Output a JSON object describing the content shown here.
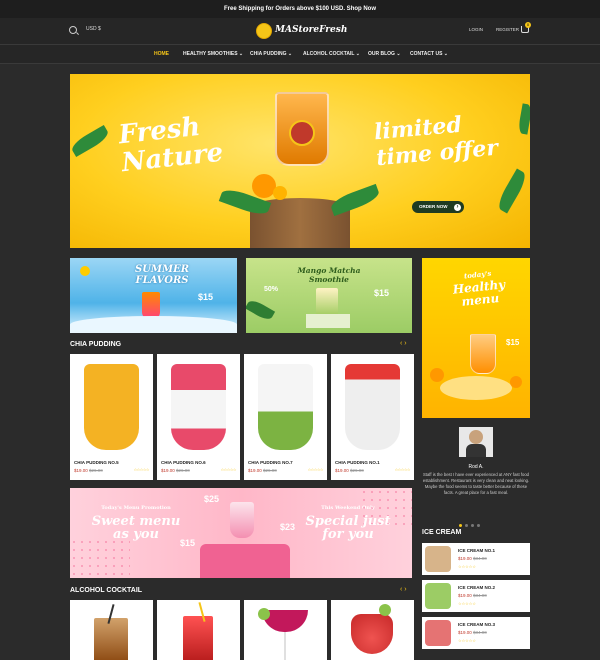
{
  "topbar": {
    "text": "Free Shipping for Orders above $100 USD. Shop Now"
  },
  "header": {
    "currency": "USD $",
    "logo_text": "MAStoreFresh",
    "login": "LOGIN",
    "register": "REGISTER",
    "cart_count": "0"
  },
  "nav": {
    "items": [
      {
        "label": "HOME"
      },
      {
        "label": "HEALTHY SMOOTHIES ⌄"
      },
      {
        "label": "CHIA PUDDING ⌄"
      },
      {
        "label": "ALCOHOL COCKTAIL ⌄"
      },
      {
        "label": "OUR BLOG ⌄"
      },
      {
        "label": "CONTACT US ⌄"
      }
    ]
  },
  "hero": {
    "line1": "Fresh",
    "line2": "Nature",
    "line3": "limited",
    "line4": "time offer",
    "button": "ORDER NOW"
  },
  "banners": {
    "summer_line1": "SUMMER",
    "summer_line2": "FLAVORS",
    "summer_price": "$15",
    "matcha_line1": "Mango Matcha",
    "matcha_line2": "Smoothie",
    "matcha_badge": "50%",
    "matcha_price": "$15",
    "side_line1": "today's",
    "side_line2": "Healthy",
    "side_line3": "menu",
    "side_price": "$15"
  },
  "chia": {
    "title": "CHIA PUDDING",
    "arrows": "‹ ›",
    "products": [
      {
        "name": "CHIA PUDDING NO.5",
        "price": "$19.00",
        "old_price": "$26.00",
        "color": "#f4b223"
      },
      {
        "name": "CHIA PUDDING NO.6",
        "price": "$19.00",
        "old_price": "$26.00",
        "color": "#e84a6a"
      },
      {
        "name": "CHIA PUDDING NO.7",
        "price": "$19.00",
        "old_price": "$26.00",
        "color": "#7cb342"
      },
      {
        "name": "CHIA PUDDING NO.1",
        "price": "$19.00",
        "old_price": "$26.00",
        "color": "#e0e0e0"
      }
    ],
    "stars": "☆☆☆☆☆"
  },
  "testimonial": {
    "name": "Rod A.",
    "text": "Staff is the best I have ever experienced at ANY fast food establishment. Restaurant is very clean and neat looking. Maybe the food seems to taste better because of these facts. A great place for a fast meal."
  },
  "promo": {
    "left_line1": "Today's Menu Promotion",
    "left_line2": "Sweet menu",
    "left_line3": "as you",
    "price1": "$25",
    "price2": "$23",
    "price3": "$15",
    "right_line1": "This Weekend Only",
    "right_line2": "Special just",
    "right_line3": "for you"
  },
  "ice_cream": {
    "title": "ICE CREAM",
    "items": [
      {
        "name": "ICE CREAM NO.1",
        "price": "$19.00",
        "old_price": "$34.00",
        "color": "#d7b48a"
      },
      {
        "name": "ICE CREAM NO.2",
        "price": "$19.00",
        "old_price": "$34.00",
        "color": "#9ccc65"
      },
      {
        "name": "ICE CREAM NO.3",
        "price": "$19.00",
        "old_price": "$34.00",
        "color": "#e57373"
      }
    ]
  },
  "alcohol": {
    "title": "ALCOHOL COCKTAIL",
    "arrows": "‹ ›",
    "colors": [
      "#b5651d",
      "#d32f2f",
      "#c2185b",
      "#e53935"
    ]
  },
  "colors": {
    "accent": "#f5c518",
    "dark": "#2b2b2b"
  }
}
